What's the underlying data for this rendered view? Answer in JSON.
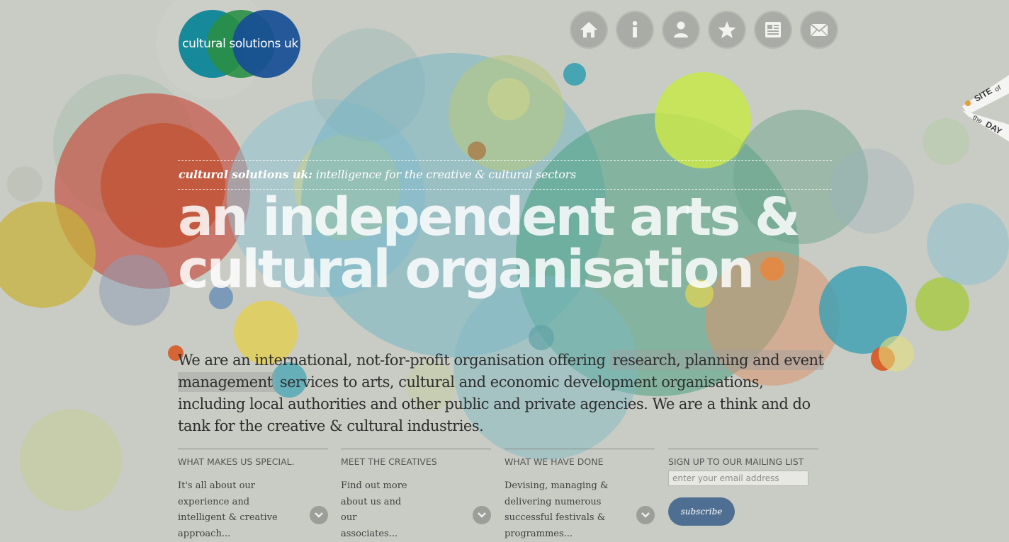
{
  "brand": {
    "logo_text": "cultural solutions uk"
  },
  "nav": [
    {
      "icon": "home-icon"
    },
    {
      "icon": "info-icon"
    },
    {
      "icon": "person-icon"
    },
    {
      "icon": "star-icon"
    },
    {
      "icon": "document-icon"
    },
    {
      "icon": "mail-icon"
    }
  ],
  "badge": {
    "line1": "SITE",
    "line2": "of",
    "line3": "the",
    "line4": "DAY"
  },
  "tagline": {
    "name": "cultural solutions uk:",
    "text": "intelligence for the creative & cultural sectors"
  },
  "headline": {
    "line1": "an independent arts &",
    "line2": "cultural organisation"
  },
  "intro": {
    "part1": "We are an international, not-for-profit organisation offering",
    "highlight": "research, planning and event management",
    "part2": "services to arts, cultural and economic development organisations, including local authorities and other public and private agencies. We are a think and do tank for the creative & cultural industries."
  },
  "columns": [
    {
      "title": "WHAT MAKES US SPECIAL.",
      "text": "It's all about our experience and intelligent & creative approach..."
    },
    {
      "title": "MEET THE CREATIVES",
      "text": "Find out more about us and our associates..."
    },
    {
      "title": "WHAT WE HAVE DONE",
      "text": "Devising, managing & delivering numerous successful festivals & programmes..."
    }
  ],
  "mailing": {
    "title": "SIGN UP TO OUR MAILING LIST",
    "placeholder": "enter your email address",
    "button": "subscribe"
  },
  "colors": {
    "background": "#c9ccc4",
    "logo_teal": "#16899a",
    "logo_green": "#2a8f45",
    "logo_blue": "#184f94",
    "subscribe": "#4f6f92"
  }
}
